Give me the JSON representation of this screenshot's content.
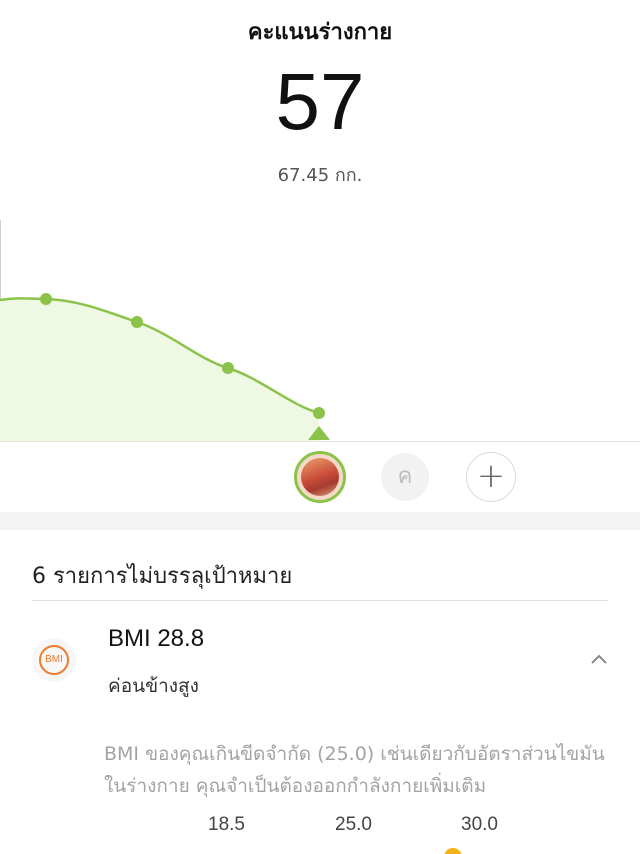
{
  "header": {
    "title": "คะแนนร่างกาย",
    "score": "57",
    "weight": "67.45 กก."
  },
  "trend_chart": {
    "type": "line",
    "line_color": "#8bc34a",
    "fill_color": "#eef8e2",
    "points_count": 4
  },
  "avatars": {
    "second_initial": "ค",
    "add_symbol": "+"
  },
  "section": {
    "title": "6 รายการไม่บรรลุเป้าหมาย"
  },
  "bmi": {
    "icon_label": "BMI",
    "value_text": "BMI 28.8",
    "status": "ค่อนข้างสูง",
    "description_line1": "BMI ของคุณเกินขีดจำกัด (25.0) เช่นเดียวกับอัตราส่วนไขมัน",
    "description_line2": "ในร่างกาย คุณจำเป็นต้องออกกำลังกายเพิ่มเติม",
    "scale": [
      "18.5",
      "25.0",
      "30.0"
    ],
    "accent_color": "#f07a28"
  }
}
